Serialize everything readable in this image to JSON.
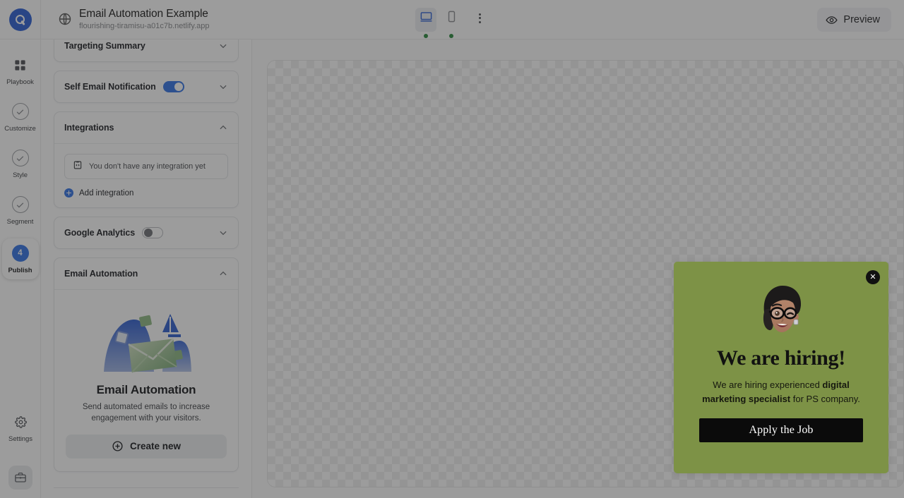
{
  "header": {
    "logo_icon": "quiz-logo-icon",
    "globe_icon": "globe-icon",
    "site_title": "Email Automation Example",
    "site_url": "flourishing-tiramisu-a01c7b.netlify.app",
    "devices": [
      {
        "name": "desktop",
        "icon": "desktop-icon",
        "active": true,
        "status": "online"
      },
      {
        "name": "mobile",
        "icon": "mobile-icon",
        "active": false,
        "status": "online"
      }
    ],
    "more_icon": "kebab-menu-icon",
    "preview_label": "Preview",
    "preview_icon": "eye-icon"
  },
  "rail": {
    "items": [
      {
        "label": "Playbook",
        "icon": "grid-icon",
        "state": "default"
      },
      {
        "label": "Customize",
        "icon": "check-circle-icon",
        "state": "complete"
      },
      {
        "label": "Style",
        "icon": "check-circle-icon",
        "state": "complete"
      },
      {
        "label": "Segment",
        "icon": "check-circle-icon",
        "state": "complete"
      },
      {
        "label": "Publish",
        "icon": "step-number-badge",
        "badge": "4",
        "state": "current"
      }
    ],
    "settings_label": "Settings",
    "settings_icon": "gear-icon",
    "briefcase_icon": "briefcase-icon"
  },
  "panel": {
    "sections": [
      {
        "title": "Targeting Summary",
        "expanded": false,
        "chevron": "chevron-down-icon"
      },
      {
        "title": "Self Email Notification",
        "expanded": false,
        "chevron": "chevron-down-icon",
        "toggle": "on"
      },
      {
        "title": "Integrations",
        "expanded": true,
        "chevron": "chevron-up-icon"
      },
      {
        "title": "Google Analytics",
        "expanded": false,
        "chevron": "chevron-down-icon",
        "toggle": "off"
      },
      {
        "title": "Email Automation",
        "expanded": true,
        "chevron": "chevron-up-icon"
      }
    ],
    "integrations": {
      "empty_text": "You don't have any integration yet",
      "empty_icon": "code-snippet-icon",
      "add_label": "Add integration",
      "add_icon": "plus-circle-icon"
    },
    "email_automation": {
      "art_icon": "email-landscape-illustration",
      "title": "Email Automation",
      "description": "Send automated emails to increase engagement with your visitors.",
      "cta_label": "Create new",
      "cta_icon": "plus-circle-outline-icon"
    }
  },
  "canvas": {
    "background": "transparent-checkerboard"
  },
  "hiring_popup": {
    "close_icon": "close-icon",
    "avatar_icon": "memoji-avatar-icon",
    "heading": "We are hiring!",
    "body_pre": "We are hiring experienced ",
    "body_bold": "digital marketing specialist",
    "body_post": " for PS company.",
    "button_label": "Apply the Job",
    "background_color": "#7d9246",
    "button_color": "#0b0b0b"
  },
  "colors": {
    "accent_blue": "#3273e6",
    "brand_blue": "#2c5fd4",
    "status_green": "#2a8a3e",
    "popup_green": "#7d9246"
  }
}
